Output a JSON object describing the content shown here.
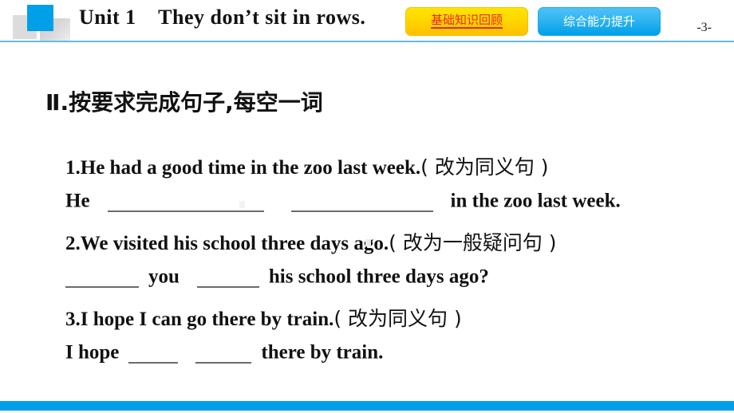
{
  "header": {
    "unit_title": "Unit 1    They don’t sit in rows.",
    "page_number": "-3-",
    "buttons": [
      {
        "label": "基础知识回顾",
        "style": "yellow",
        "text_color": "#e8262b",
        "bg_color": "#ffd900"
      },
      {
        "label": "综合能力提升",
        "style": "blue",
        "text_color": "#ffffff",
        "bg_color": "#00a0e9"
      }
    ],
    "logo": {
      "blue_color": "#00a0e9",
      "grey_color": "#dcdcdc"
    },
    "rule_color": "#64b9f0"
  },
  "content": {
    "section_heading": "Ⅱ.按要求完成句子,每空一词",
    "questions": [
      {
        "number": "1.",
        "prompt_en": "He had a good time in the zoo last week.",
        "prompt_cn": "( 改为同义句 )",
        "answer_pre": "He",
        "answer_mid": "",
        "answer_post": "in the zoo last week.",
        "blanks": 2
      },
      {
        "number": "2.",
        "prompt_en": "We visited his school three days ago.",
        "prompt_cn": "( 改为一般疑问句 )",
        "answer_pre": "",
        "answer_mid": "you",
        "answer_post": "his school three days ago?",
        "blanks": 2
      },
      {
        "number": "3.",
        "prompt_en": "I hope I can go there by train.",
        "prompt_cn": "( 改为同义句 )",
        "answer_pre": "I hope",
        "answer_mid": "",
        "answer_post": "there by train.",
        "blanks": 2
      }
    ]
  },
  "footer": {
    "bar_color": "#00a0e9"
  }
}
